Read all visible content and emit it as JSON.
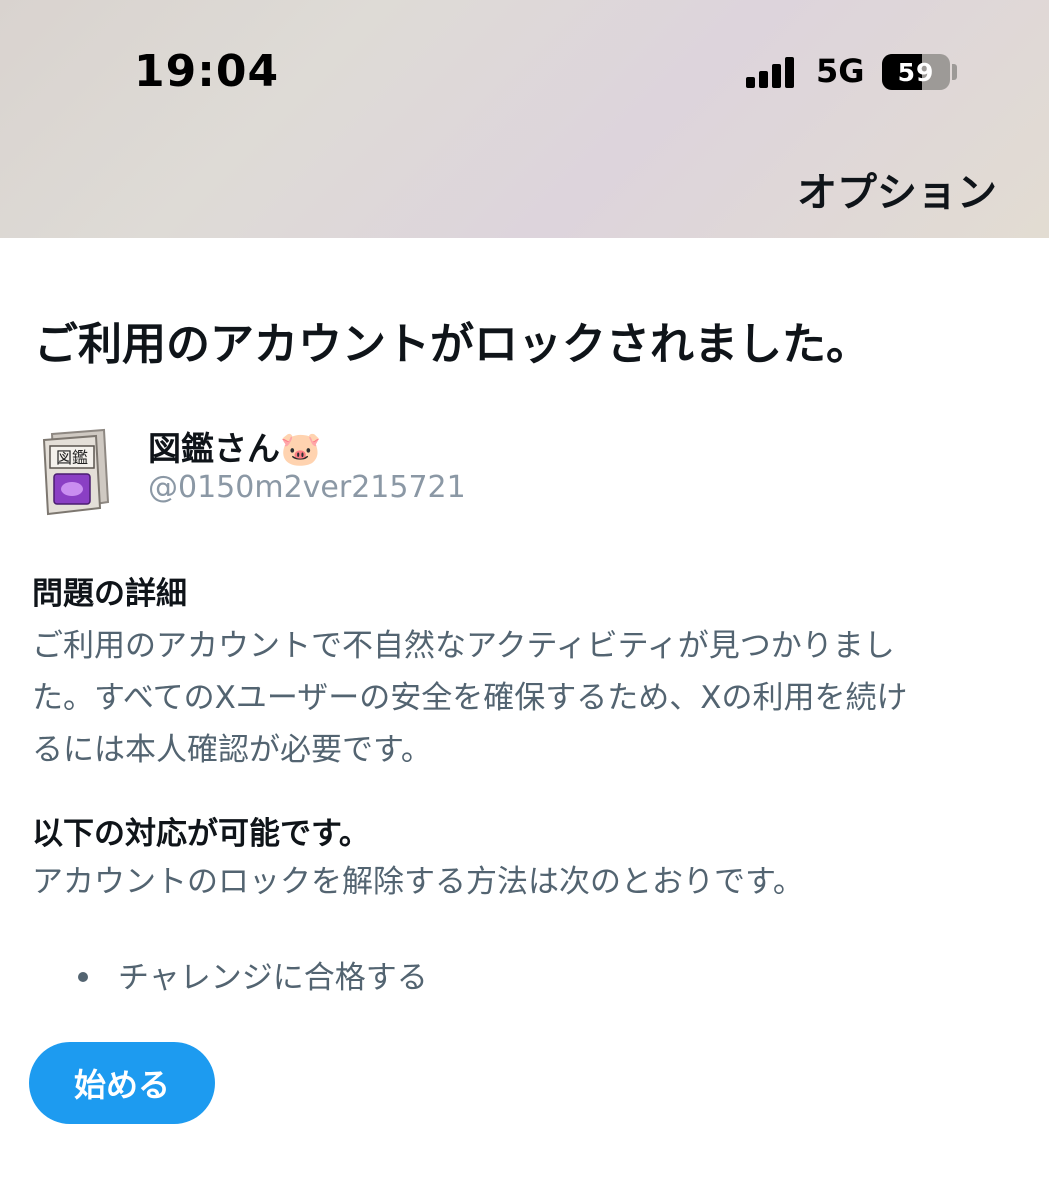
{
  "status_bar": {
    "time": "19:04",
    "network": "5G",
    "battery_level": "59",
    "battery_fraction": 0.59
  },
  "header": {
    "options_label": "オプション"
  },
  "main": {
    "title": "ご利用のアカウントがロックされました。",
    "account": {
      "display_name": "図鑑さん🐷",
      "handle": "@0150m2ver215721"
    },
    "details_heading": "問題の詳細",
    "details_lines": [
      "ご利用のアカウントで不自然なアクティビティが見つかりまし",
      "た。すべてのXユーザーの安全を確保するため、Xの利用を続け",
      "るには本人確認が必要です。"
    ],
    "actions_heading": "以下の対応が可能です。",
    "actions_intro": "アカウントのロックを解除する方法は次のとおりです。",
    "actions_list": [
      "チャレンジに合格する"
    ],
    "start_button": "始める"
  },
  "colors": {
    "accent": "#1d9bf0",
    "secondary_text": "#536471",
    "handle_text": "#8b98a5"
  }
}
